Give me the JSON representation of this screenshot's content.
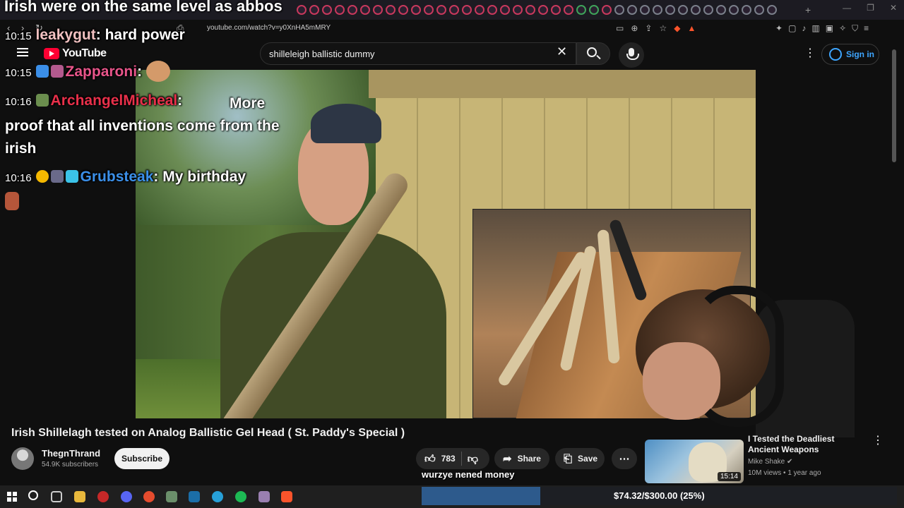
{
  "overlay": {
    "title": "Irish were on the same level as abbos"
  },
  "chat": [
    {
      "time": "10:15",
      "user": "leakygut",
      "user_color": "#f0c0c0",
      "msg": "hard power"
    },
    {
      "time": "10:15",
      "user": "Zapparoni",
      "user_color": "#e8558a",
      "msg": ""
    },
    {
      "time": "10:16",
      "user": "ArchangelMicheal",
      "user_color": "#e8304a",
      "msg": "More proof that all inventions come from the irish"
    },
    {
      "time": "10:16",
      "user": "Grubsteak",
      "user_color": "#3b8fe8",
      "msg": "My birthday"
    }
  ],
  "browser": {
    "url": "youtube.com/watch?v=y0XnHA5mMRY"
  },
  "youtube": {
    "logo_text": "YouTube",
    "search_query": "shilleleigh ballistic dummy",
    "sign_in": "Sign in"
  },
  "video": {
    "title": "Irish Shillelagh tested on Analog Ballistic Gel Head ( St. Paddy's Special )",
    "channel": "ThegnThrand",
    "subscribers": "54.9K subscribers",
    "subscribe_label": "Subscribe",
    "likes": "783",
    "share_label": "Share",
    "save_label": "Save"
  },
  "recommended": {
    "title": "I Tested the Deadliest Ancient Weapons",
    "channel": "Mike Shake",
    "views": "10M views",
    "age": "1 year ago",
    "meta_sep": "•",
    "duration": "15:14"
  },
  "donation": {
    "message": "wurzye nened money",
    "goal_text": "$74.32/$300.00 (25%)",
    "progress": 0.25
  },
  "colors": {
    "accent_blue": "#3ea6ff",
    "youtube_red": "#ff0033",
    "goal_fill": "#2d5a8c"
  },
  "icons": [
    "menu-icon",
    "search-icon",
    "mic-icon",
    "kebab-icon",
    "account-icon",
    "like-icon",
    "dislike-icon",
    "share-icon",
    "save-icon",
    "more-icon",
    "windows-icon"
  ]
}
